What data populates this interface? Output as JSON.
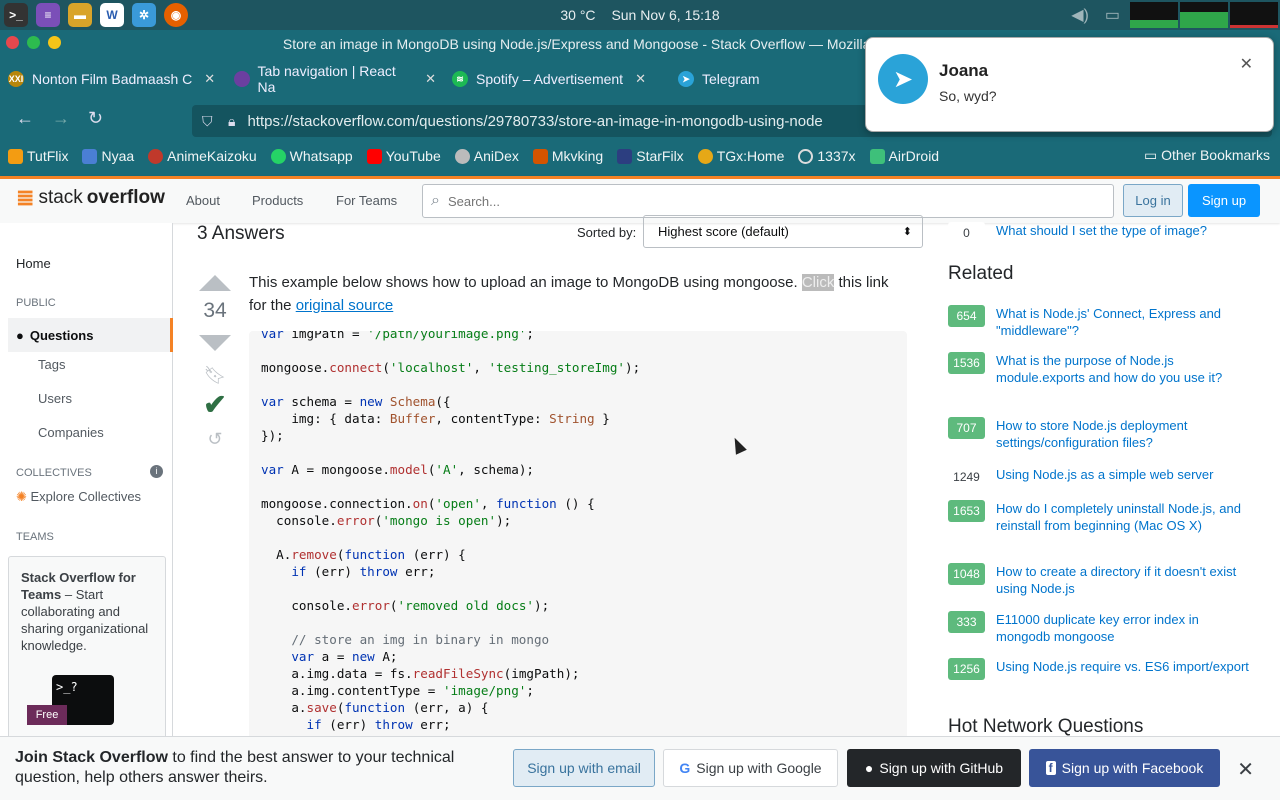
{
  "os": {
    "temperature": "30 °C",
    "datetime": "Sun Nov  6, 15:18"
  },
  "window": {
    "title": "Store an image in MongoDB using Node.js/Express and Mongoose - Stack Overflow — Mozilla Firefox"
  },
  "tabs": [
    {
      "label": "Nonton Film Badmaash C",
      "close": "✕"
    },
    {
      "label": "Tab navigation | React Na",
      "close": "✕"
    },
    {
      "label": "Spotify – Advertisement",
      "close": "✕"
    },
    {
      "label": "Telegram",
      "close": "✕"
    }
  ],
  "url": "https://stackoverflow.com/questions/29780733/store-an-image-in-mongodb-using-node",
  "bookmarks": [
    "TutFlix",
    "Nyaa",
    "AnimeKaizoku",
    "Whatsapp",
    "YouTube",
    "AniDex",
    "Mkvking",
    "StarFilx",
    "TGx:Home",
    "1337x",
    "AirDroid"
  ],
  "other_bookmarks": "Other Bookmarks",
  "so_header": {
    "logo_a": "stack",
    "logo_b": "overflow",
    "about": "About",
    "products": "Products",
    "for_teams": "For Teams",
    "search_placeholder": "Search...",
    "login": "Log in",
    "signup": "Sign up"
  },
  "left_nav": {
    "home": "Home",
    "public": "PUBLIC",
    "questions": "Questions",
    "tags": "Tags",
    "users": "Users",
    "companies": "Companies",
    "collectives": "COLLECTIVES",
    "explore_collectives": "Explore Collectives",
    "teams": "TEAMS",
    "teams_box_bold": "Stack Overflow for Teams",
    "teams_box_text": " – Start collaborating and sharing organizational knowledge.",
    "free_label": "Free"
  },
  "main": {
    "answers_title": "3 Answers",
    "sorted_by": "Sorted by:",
    "sort_value": "Highest score (default)",
    "score": "34",
    "answer_text_1": "This example below shows how to upload an image to MongoDB using mongoose.",
    "answer_text_hl": "Click",
    "answer_text_2": "this link for the",
    "answer_link": "original source"
  },
  "code_lines": [
    "var imgPath = '/path/yourimage.png';",
    "",
    "mongoose.connect('localhost', 'testing_storeImg');",
    "",
    "var schema = new Schema({",
    "    img: { data: Buffer, contentType: String }",
    "});",
    "",
    "var A = mongoose.model('A', schema);",
    "",
    "mongoose.connection.on('open', function () {",
    "  console.error('mongo is open');",
    "",
    "  A.remove(function (err) {",
    "    if (err) throw err;",
    "",
    "    console.error('removed old docs');",
    "",
    "    // store an img in binary in mongo",
    "    var a = new A;",
    "    a.img.data = fs.readFileSync(imgPath);",
    "    a.img.contentType = 'image/png';",
    "    a.save(function (err, a) {",
    "      if (err) throw err;"
  ],
  "right": {
    "top_q": {
      "count": "0",
      "title": "What should I set the type of image?"
    },
    "related_title": "Related",
    "related": [
      {
        "count": "654",
        "title": "What is Node.js' Connect, Express and \"middleware\"?",
        "accepted": true
      },
      {
        "count": "1536",
        "title": "What is the purpose of Node.js module.exports and how do you use it?",
        "accepted": true
      },
      {
        "count": "707",
        "title": "How to store Node.js deployment settings/configuration files?",
        "accepted": true
      },
      {
        "count": "1249",
        "title": "Using Node.js as a simple web server",
        "accepted": false
      },
      {
        "count": "1653",
        "title": "How do I completely uninstall Node.js, and reinstall from beginning (Mac OS X)",
        "accepted": true
      },
      {
        "count": "1048",
        "title": "How to create a directory if it doesn't exist using Node.js",
        "accepted": true
      },
      {
        "count": "333",
        "title": "E11000 duplicate key error index in mongodb mongoose",
        "accepted": true
      },
      {
        "count": "1256",
        "title": "Using Node.js require vs. ES6 import/export",
        "accepted": true
      }
    ],
    "hot_title": "Hot Network Questions"
  },
  "banner": {
    "bold": "Join Stack Overflow",
    "text": " to find the best answer to your technical question, help others answer theirs.",
    "email": "Sign up with email",
    "google": "Sign up with Google",
    "github": "Sign up with GitHub",
    "facebook": "Sign up with Facebook"
  },
  "notification": {
    "name": "Joana",
    "message": "So, wyd?"
  }
}
